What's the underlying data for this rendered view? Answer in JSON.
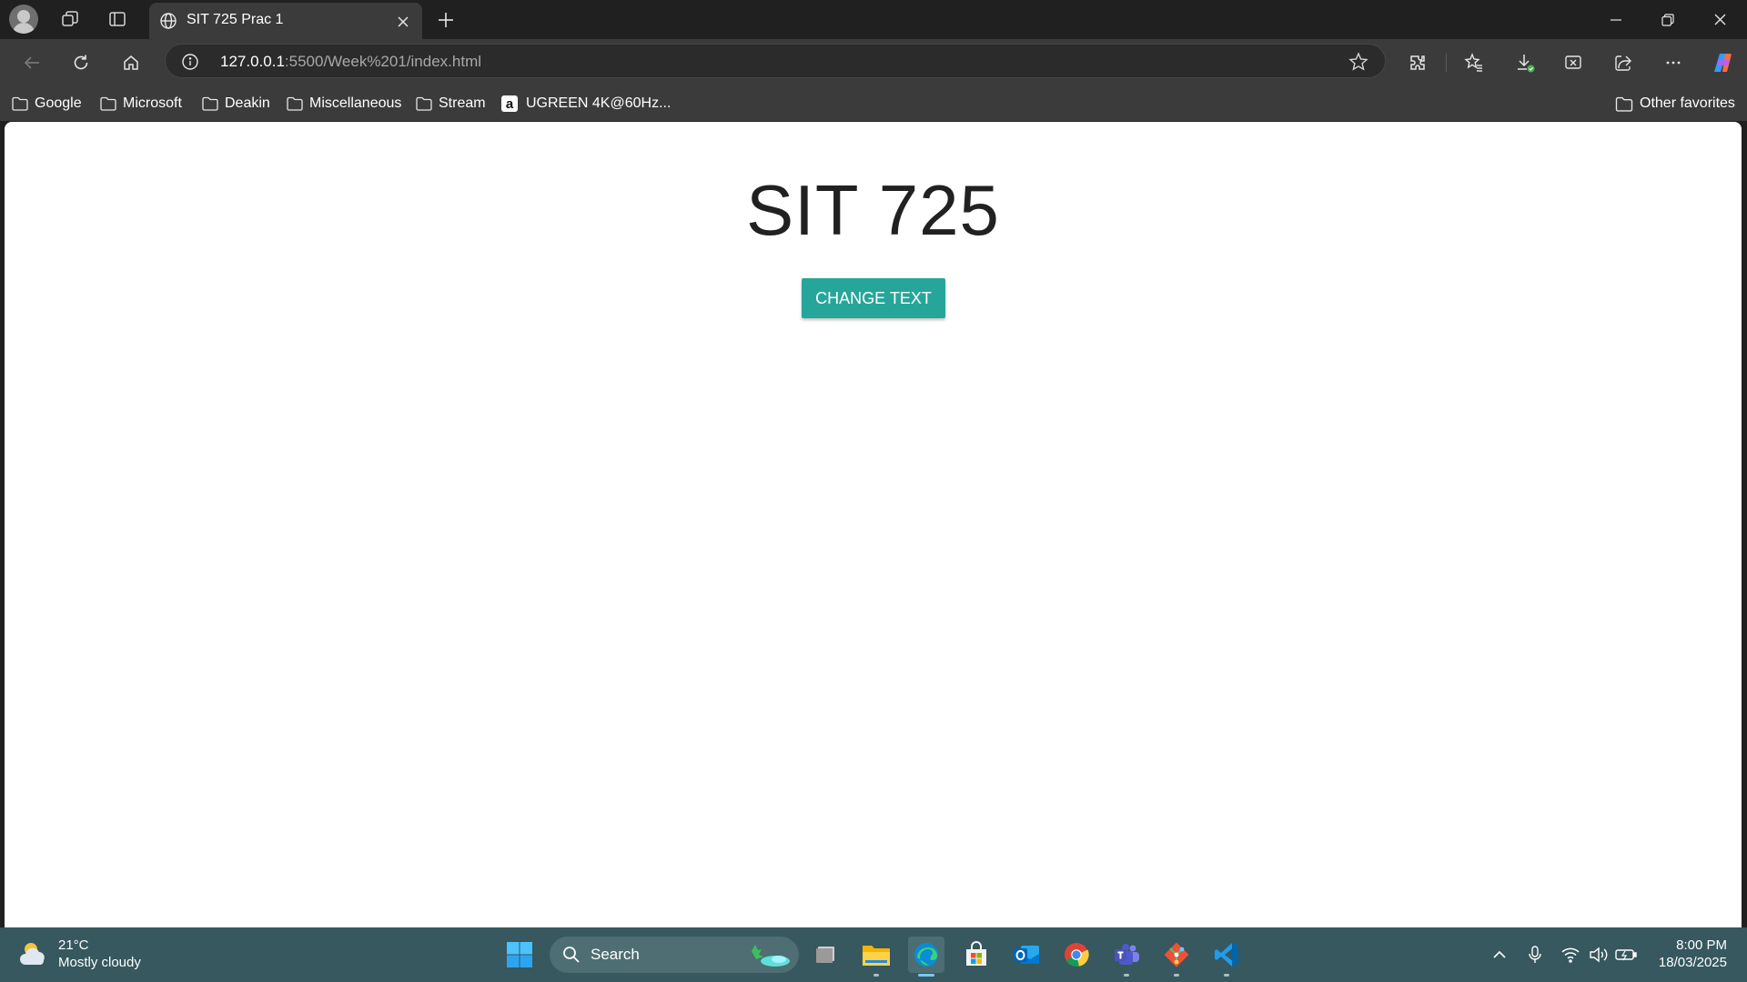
{
  "browser": {
    "tab_title": "SIT 725 Prac 1",
    "url_host": "127.0.0.1",
    "url_rest": ":5500/Week%201/index.html"
  },
  "bookmarks": [
    {
      "label": "Google"
    },
    {
      "label": "Microsoft"
    },
    {
      "label": "Deakin"
    },
    {
      "label": "Miscellaneous"
    },
    {
      "label": "Stream"
    },
    {
      "label": "UGREEN 4K@60Hz..."
    }
  ],
  "bookmarks_other": "Other favorites",
  "page": {
    "heading": "SIT 725",
    "button_label": "CHANGE TEXT",
    "button_color": "#26a69a"
  },
  "taskbar": {
    "weather_temp": "21°C",
    "weather_desc": "Mostly cloudy",
    "search_label": "Search",
    "time": "8:00 PM",
    "date": "18/03/2025",
    "apps": [
      "start-icon",
      "search",
      "task-view-icon",
      "file-explorer-icon",
      "edge-icon",
      "ms-store-icon",
      "outlook-icon",
      "chrome-icon",
      "teams-icon",
      "git-icon",
      "vscode-icon"
    ]
  }
}
